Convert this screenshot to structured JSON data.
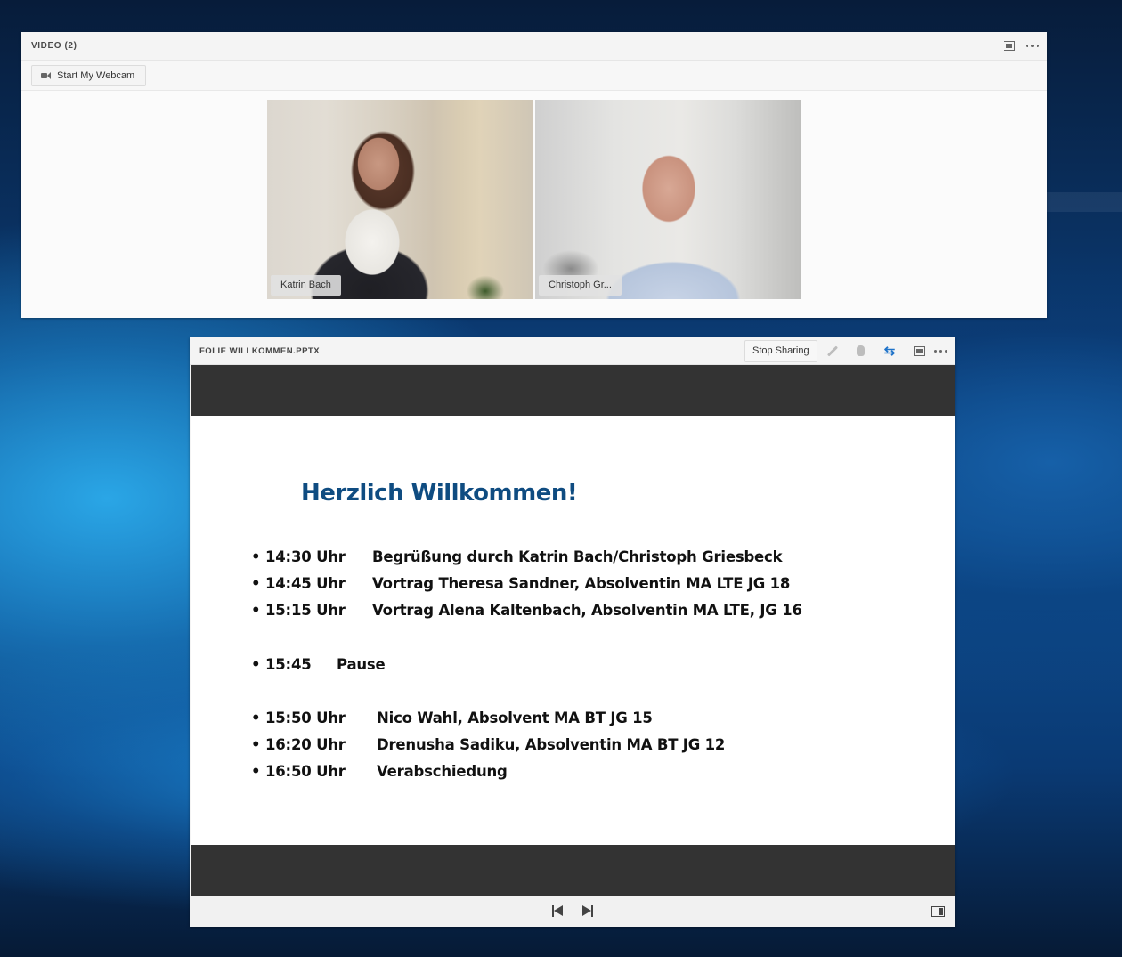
{
  "video_pod": {
    "title": "VIDEO (2)",
    "webcam_button": "Start My Webcam",
    "participants": [
      {
        "name": "Katrin Bach"
      },
      {
        "name": "Christoph Gr..."
      }
    ]
  },
  "share_pod": {
    "title": "FOLIE WILLKOMMEN.PPTX",
    "stop_sharing": "Stop Sharing",
    "slide": {
      "heading": "Herzlich Willkommen!",
      "agenda": [
        {
          "bullet": "•",
          "time": "14:30 Uhr",
          "text": "Begrüßung durch Katrin Bach/Christoph Griesbeck"
        },
        {
          "bullet": "•",
          "time": "14:45 Uhr",
          "text": "Vortrag Theresa Sandner, Absolventin MA LTE JG 18"
        },
        {
          "bullet": "•",
          "time": "15:15 Uhr",
          "text": "Vortrag Alena Kaltenbach, Absolventin MA LTE, JG 16"
        },
        {
          "bullet": "•",
          "time": "15:45",
          "text": "Pause"
        },
        {
          "bullet": "•",
          "time": "15:50 Uhr",
          "text": "Nico Wahl, Absolvent MA BT JG 15"
        },
        {
          "bullet": "•",
          "time": "16:20 Uhr",
          "text": "Drenusha Sadiku, Absolventin MA BT JG 12"
        },
        {
          "bullet": "•",
          "time": "16:50 Uhr",
          "text": "Verabschiedung"
        }
      ]
    }
  },
  "colors": {
    "heading": "#0f4c81",
    "slide_bars": "#333333",
    "sync_icon": "#1f73c9"
  }
}
